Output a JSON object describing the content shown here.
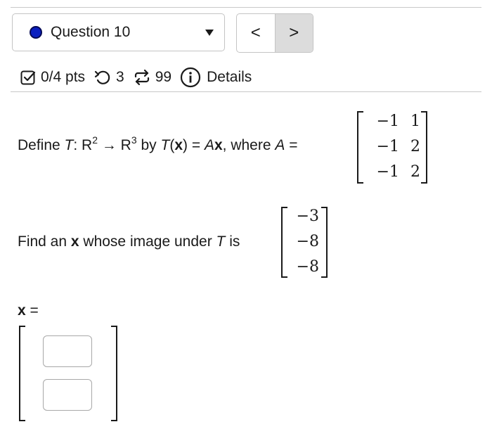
{
  "header": {
    "question_label": "Question 10",
    "status_color": "#0a1fbf",
    "prev_label": "<",
    "next_label": ">"
  },
  "stats": {
    "points": "0/4 pts",
    "retries": "3",
    "submissions": "99",
    "details_label": "Details"
  },
  "problem": {
    "line1": {
      "p1": "Define ",
      "T": "T",
      "p2": ": R",
      "exp_domain": "2",
      "arrow": " → R",
      "exp_codomain": "3",
      "p3": " by ",
      "T2": "T",
      "p4": "(",
      "x": "x",
      "p5": ") = ",
      "A": "A",
      "x2": "x",
      "p6": ", where ",
      "A2": "A",
      "p7": " ="
    },
    "matrix_A": [
      [
        "−1",
        "1"
      ],
      [
        "−1",
        "2"
      ],
      [
        "−1",
        "2"
      ]
    ],
    "line2": {
      "p1": "Find an ",
      "x": "x",
      "p2": " whose image under ",
      "T": "T",
      "p3": " is"
    },
    "vector_b": [
      "−3",
      "−8",
      "−8"
    ]
  },
  "answer": {
    "label_x": "x",
    "label_eq": " =",
    "inputs": [
      "",
      ""
    ]
  },
  "icons": [
    "check-square-icon",
    "retry-icon",
    "submissions-icon",
    "info-icon",
    "caret-down-icon"
  ]
}
